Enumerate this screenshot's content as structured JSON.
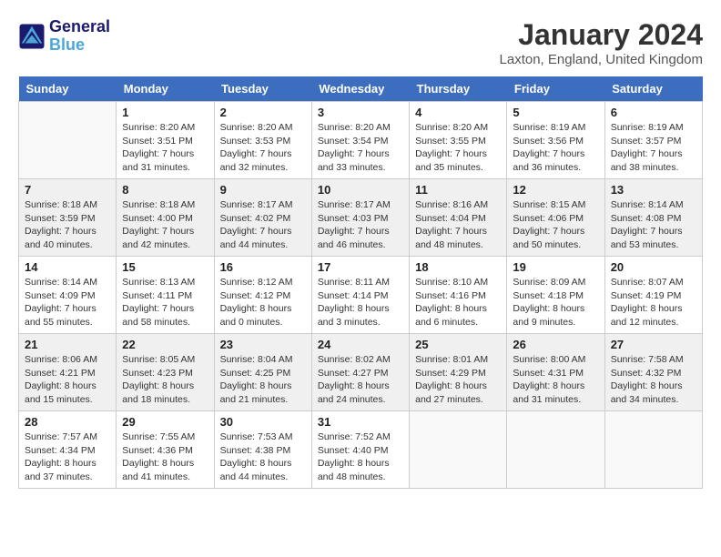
{
  "header": {
    "logo_line1": "General",
    "logo_line2": "Blue",
    "month_year": "January 2024",
    "location": "Laxton, England, United Kingdom"
  },
  "weekdays": [
    "Sunday",
    "Monday",
    "Tuesday",
    "Wednesday",
    "Thursday",
    "Friday",
    "Saturday"
  ],
  "weeks": [
    [
      {
        "day": "",
        "info": ""
      },
      {
        "day": "1",
        "info": "Sunrise: 8:20 AM\nSunset: 3:51 PM\nDaylight: 7 hours\nand 31 minutes."
      },
      {
        "day": "2",
        "info": "Sunrise: 8:20 AM\nSunset: 3:53 PM\nDaylight: 7 hours\nand 32 minutes."
      },
      {
        "day": "3",
        "info": "Sunrise: 8:20 AM\nSunset: 3:54 PM\nDaylight: 7 hours\nand 33 minutes."
      },
      {
        "day": "4",
        "info": "Sunrise: 8:20 AM\nSunset: 3:55 PM\nDaylight: 7 hours\nand 35 minutes."
      },
      {
        "day": "5",
        "info": "Sunrise: 8:19 AM\nSunset: 3:56 PM\nDaylight: 7 hours\nand 36 minutes."
      },
      {
        "day": "6",
        "info": "Sunrise: 8:19 AM\nSunset: 3:57 PM\nDaylight: 7 hours\nand 38 minutes."
      }
    ],
    [
      {
        "day": "7",
        "info": "Sunrise: 8:18 AM\nSunset: 3:59 PM\nDaylight: 7 hours\nand 40 minutes."
      },
      {
        "day": "8",
        "info": "Sunrise: 8:18 AM\nSunset: 4:00 PM\nDaylight: 7 hours\nand 42 minutes."
      },
      {
        "day": "9",
        "info": "Sunrise: 8:17 AM\nSunset: 4:02 PM\nDaylight: 7 hours\nand 44 minutes."
      },
      {
        "day": "10",
        "info": "Sunrise: 8:17 AM\nSunset: 4:03 PM\nDaylight: 7 hours\nand 46 minutes."
      },
      {
        "day": "11",
        "info": "Sunrise: 8:16 AM\nSunset: 4:04 PM\nDaylight: 7 hours\nand 48 minutes."
      },
      {
        "day": "12",
        "info": "Sunrise: 8:15 AM\nSunset: 4:06 PM\nDaylight: 7 hours\nand 50 minutes."
      },
      {
        "day": "13",
        "info": "Sunrise: 8:14 AM\nSunset: 4:08 PM\nDaylight: 7 hours\nand 53 minutes."
      }
    ],
    [
      {
        "day": "14",
        "info": "Sunrise: 8:14 AM\nSunset: 4:09 PM\nDaylight: 7 hours\nand 55 minutes."
      },
      {
        "day": "15",
        "info": "Sunrise: 8:13 AM\nSunset: 4:11 PM\nDaylight: 7 hours\nand 58 minutes."
      },
      {
        "day": "16",
        "info": "Sunrise: 8:12 AM\nSunset: 4:12 PM\nDaylight: 8 hours\nand 0 minutes."
      },
      {
        "day": "17",
        "info": "Sunrise: 8:11 AM\nSunset: 4:14 PM\nDaylight: 8 hours\nand 3 minutes."
      },
      {
        "day": "18",
        "info": "Sunrise: 8:10 AM\nSunset: 4:16 PM\nDaylight: 8 hours\nand 6 minutes."
      },
      {
        "day": "19",
        "info": "Sunrise: 8:09 AM\nSunset: 4:18 PM\nDaylight: 8 hours\nand 9 minutes."
      },
      {
        "day": "20",
        "info": "Sunrise: 8:07 AM\nSunset: 4:19 PM\nDaylight: 8 hours\nand 12 minutes."
      }
    ],
    [
      {
        "day": "21",
        "info": "Sunrise: 8:06 AM\nSunset: 4:21 PM\nDaylight: 8 hours\nand 15 minutes."
      },
      {
        "day": "22",
        "info": "Sunrise: 8:05 AM\nSunset: 4:23 PM\nDaylight: 8 hours\nand 18 minutes."
      },
      {
        "day": "23",
        "info": "Sunrise: 8:04 AM\nSunset: 4:25 PM\nDaylight: 8 hours\nand 21 minutes."
      },
      {
        "day": "24",
        "info": "Sunrise: 8:02 AM\nSunset: 4:27 PM\nDaylight: 8 hours\nand 24 minutes."
      },
      {
        "day": "25",
        "info": "Sunrise: 8:01 AM\nSunset: 4:29 PM\nDaylight: 8 hours\nand 27 minutes."
      },
      {
        "day": "26",
        "info": "Sunrise: 8:00 AM\nSunset: 4:31 PM\nDaylight: 8 hours\nand 31 minutes."
      },
      {
        "day": "27",
        "info": "Sunrise: 7:58 AM\nSunset: 4:32 PM\nDaylight: 8 hours\nand 34 minutes."
      }
    ],
    [
      {
        "day": "28",
        "info": "Sunrise: 7:57 AM\nSunset: 4:34 PM\nDaylight: 8 hours\nand 37 minutes."
      },
      {
        "day": "29",
        "info": "Sunrise: 7:55 AM\nSunset: 4:36 PM\nDaylight: 8 hours\nand 41 minutes."
      },
      {
        "day": "30",
        "info": "Sunrise: 7:53 AM\nSunset: 4:38 PM\nDaylight: 8 hours\nand 44 minutes."
      },
      {
        "day": "31",
        "info": "Sunrise: 7:52 AM\nSunset: 4:40 PM\nDaylight: 8 hours\nand 48 minutes."
      },
      {
        "day": "",
        "info": ""
      },
      {
        "day": "",
        "info": ""
      },
      {
        "day": "",
        "info": ""
      }
    ]
  ]
}
